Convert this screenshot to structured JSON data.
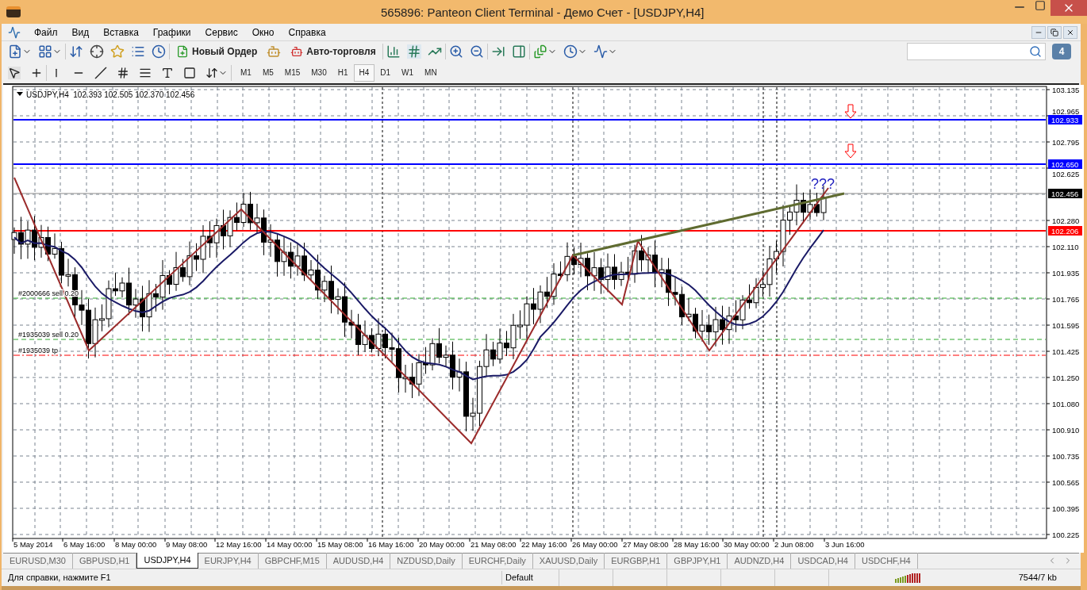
{
  "window": {
    "title": "565896: Panteon Client Terminal - Демо Счет - [USDJPY,H4]"
  },
  "menu": {
    "items": [
      "Файл",
      "Вид",
      "Вставка",
      "Графики",
      "Сервис",
      "Окно",
      "Справка"
    ]
  },
  "toolbar": {
    "new_order": "Новый Ордер",
    "auto_trading": "Авто-торговля",
    "notifications": "4"
  },
  "timeframes": [
    {
      "label": "M1",
      "selected": false
    },
    {
      "label": "M5",
      "selected": false
    },
    {
      "label": "M15",
      "selected": false
    },
    {
      "label": "M30",
      "selected": false
    },
    {
      "label": "H1",
      "selected": false
    },
    {
      "label": "H4",
      "selected": true
    },
    {
      "label": "D1",
      "selected": false
    },
    {
      "label": "W1",
      "selected": false
    },
    {
      "label": "MN",
      "selected": false
    }
  ],
  "chart": {
    "info": "USDJPY,H4  102.393 102.505 102.370 102.456",
    "price_ticks": [
      "103.135",
      "102.965",
      "102.795",
      "102.625",
      "102.280",
      "102.110",
      "101.935",
      "101.765",
      "101.595",
      "101.425",
      "101.250",
      "101.080",
      "100.910",
      "100.735",
      "100.565",
      "100.395",
      "100.225"
    ],
    "date_ticks": [
      "5 May 2014",
      "6 May 16:00",
      "8 May 00:00",
      "9 May 08:00",
      "12 May 16:00",
      "14 May 00:00",
      "15 May 08:00",
      "16 May 16:00",
      "20 May 00:00",
      "21 May 08:00",
      "22 May 16:00",
      "26 May 00:00",
      "27 May 08:00",
      "28 May 16:00",
      "30 May 00:00",
      "2 Jun 08:00",
      "3 Jun 16:00"
    ],
    "price_labels": [
      {
        "text": "102.933",
        "color": "#0000ff"
      },
      {
        "text": "102.650",
        "color": "#0000ff"
      },
      {
        "text": "102.456",
        "color": "#000000"
      },
      {
        "text": "102.206",
        "color": "#ff0000"
      }
    ],
    "orders": [
      {
        "text": "#2000666 sell 0.20",
        "kind": "sell"
      },
      {
        "text": "#1935039 sell 0.20",
        "kind": "sell"
      },
      {
        "text": "#1935039 tp",
        "kind": "tp"
      }
    ],
    "annotation": "???"
  },
  "tabs": [
    {
      "label": "EURUSD,M30",
      "selected": false
    },
    {
      "label": "GBPUSD,H1",
      "selected": false
    },
    {
      "label": "USDJPY,H4",
      "selected": true
    },
    {
      "label": "EURJPY,H4",
      "selected": false
    },
    {
      "label": "GBPCHF,M15",
      "selected": false
    },
    {
      "label": "AUDUSD,H4",
      "selected": false
    },
    {
      "label": "NZDUSD,Daily",
      "selected": false
    },
    {
      "label": "EURCHF,Daily",
      "selected": false
    },
    {
      "label": "XAUUSD,Daily",
      "selected": false
    },
    {
      "label": "EURGBP,H1",
      "selected": false
    },
    {
      "label": "GBPJPY,H1",
      "selected": false
    },
    {
      "label": "AUDNZD,H4",
      "selected": false
    },
    {
      "label": "USDCAD,H4",
      "selected": false
    },
    {
      "label": "USDCHF,H4",
      "selected": false
    }
  ],
  "status_bar": {
    "help": "Для справки, нажмите F1",
    "profile": "Default",
    "traffic": "7544/7 kb"
  }
}
